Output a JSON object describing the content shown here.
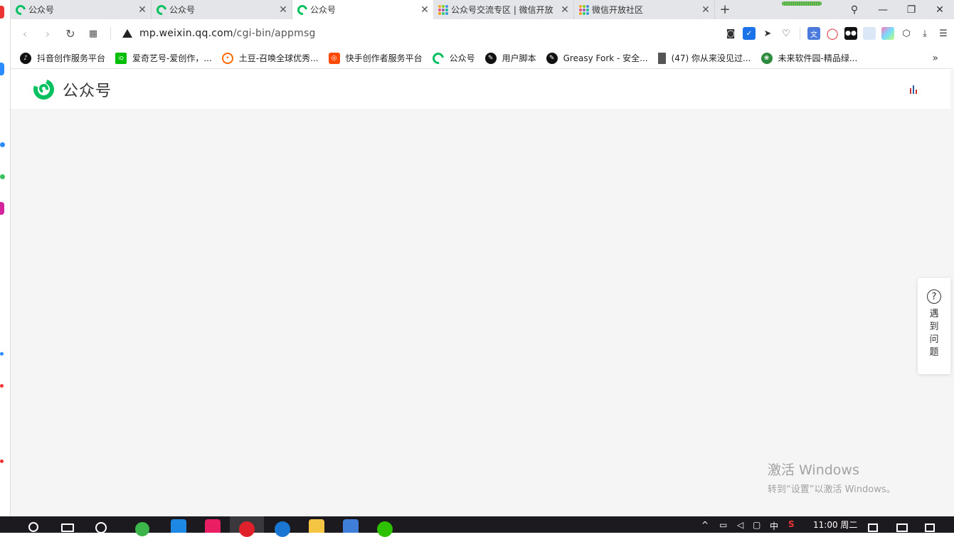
{
  "browser": {
    "tabs": [
      {
        "title": "公众号",
        "icon": "wechat-mp-icon",
        "active": false
      },
      {
        "title": "公众号",
        "icon": "wechat-mp-icon",
        "active": false
      },
      {
        "title": "公众号",
        "icon": "wechat-mp-icon",
        "active": true
      },
      {
        "title": "公众号交流专区 | 微信开放",
        "icon": "wechat-open-grid-icon",
        "active": false
      },
      {
        "title": "微信开放社区",
        "icon": "wechat-open-grid-icon",
        "active": false
      }
    ],
    "new_tab_label": "+",
    "window_controls": {
      "minimize": "—",
      "restore": "❐",
      "close": "✕"
    },
    "address": {
      "security_icon": "warning-icon",
      "url_host": "mp.weixin.qq.com",
      "url_path": "/cgi-bin/appmsg"
    },
    "bookmarks": [
      {
        "label": "抖音创作服务平台",
        "icon": "douyin-icon",
        "color": "#111111"
      },
      {
        "label": "爱奇艺号-爱创作，...",
        "icon": "iqiyi-icon",
        "color": "#00be06"
      },
      {
        "label": "土豆-召唤全球优秀...",
        "icon": "tudou-icon",
        "color": "#ff6a00"
      },
      {
        "label": "快手创作者服务平台",
        "icon": "kuaishou-icon",
        "color": "#ff4906"
      },
      {
        "label": "公众号",
        "icon": "wechat-mp-icon",
        "color": "#07c160"
      },
      {
        "label": "用户脚本",
        "icon": "greasyfork-icon",
        "color": "#111111"
      },
      {
        "label": "Greasy Fork - 安全...",
        "icon": "greasyfork-icon",
        "color": "#111111"
      },
      {
        "label": "(47) 你从来没见过...",
        "icon": "document-icon",
        "color": "#555555"
      },
      {
        "label": "未来软件园-精品绿...",
        "icon": "weilai-icon",
        "color": "#2e8b3e"
      }
    ],
    "more_bookmarks": "»"
  },
  "page": {
    "brand": "公众号",
    "help_label": "遇到问题",
    "accent_color": "#07c160"
  },
  "watermark": {
    "line1": "激活 Windows",
    "line2": "转到“设置”以激活 Windows。"
  },
  "taskbar": {
    "clock": "11:00 周二",
    "ime": "中"
  }
}
